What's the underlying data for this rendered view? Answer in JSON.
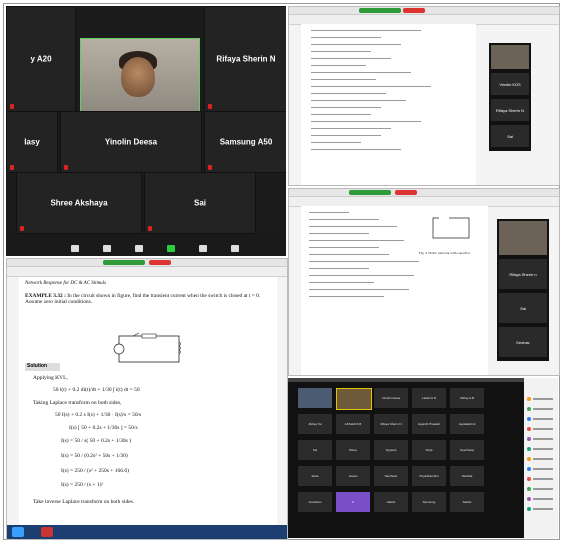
{
  "gallery": {
    "tiles": [
      {
        "name": "y A20"
      },
      {
        "name": "Rifaya Sherin N"
      },
      {
        "name": "lasy"
      },
      {
        "name": "Yinolin Deesa"
      },
      {
        "name": "Samsung A50"
      },
      {
        "name": "Shree Akshaya"
      },
      {
        "name": "Sai"
      }
    ]
  },
  "doc_top": {
    "side_tiles": [
      "Vinolin KDS",
      "Rifaya Sherin N",
      "Sai"
    ]
  },
  "doc_mid": {
    "side_tiles": [
      "Rifaya Sherin n",
      "Sai",
      "Keshav"
    ],
    "fig_caption": "Fig. 3.76 RC network with capacitor"
  },
  "doc_big": {
    "header": "Network Response for DC & AC Stimuls",
    "example_label": "EXAMPLE 3.32 :",
    "example_text": "In the circuit shown in figure, find the transient current when the switch is closed at t = 0. Assume zero initial conditions.",
    "solution_label": "Solution",
    "applying": "Applying KVL,",
    "eq1": "50 i(t) + 0.2 di(t)/dt + 1/30 ∫ i(t) dt = 50",
    "taking": "Taking Laplace transform on both sides,",
    "eq2": "50 I(s) + 0.2 s I(s) + 1/30 · I(s)/s = 50/s",
    "eq3": "I(s) [ 50 + 0.2s + 1/30s ] = 50/s",
    "eq4": "I(s) = 50 / s( 50 + 0.2s + 1/30s )",
    "eq5": "I(s) = 50 / (0.2s² + 50s + 1/30)",
    "eq6": "I(s) = 250 / (s² + 250s + 166.6)",
    "eq7": "I(s) = 250 / (s + 1)²",
    "footer": "Take inverse Laplace transform on both sides."
  },
  "participants": {
    "row1": [
      "",
      "",
      "Vinolin Deesa",
      "Lakshmi R",
      "Abhay A.B"
    ],
    "row2": [
      "Abhay Tai",
      "AKSHAYA B",
      "Rifaya Sherin N",
      "Jayanth Prakash",
      "Jayalakshmi"
    ],
    "row3": [
      "Sai",
      "Shree",
      "Vignesh",
      "Priya",
      "Keerthana"
    ],
    "row4": [
      "Suba",
      "Janani",
      "Santhosh",
      "Priyadharshini",
      "Nandha"
    ],
    "row5": [
      "Gowtham",
      "S",
      "Harish",
      "Samsung",
      "Sabari"
    ]
  }
}
